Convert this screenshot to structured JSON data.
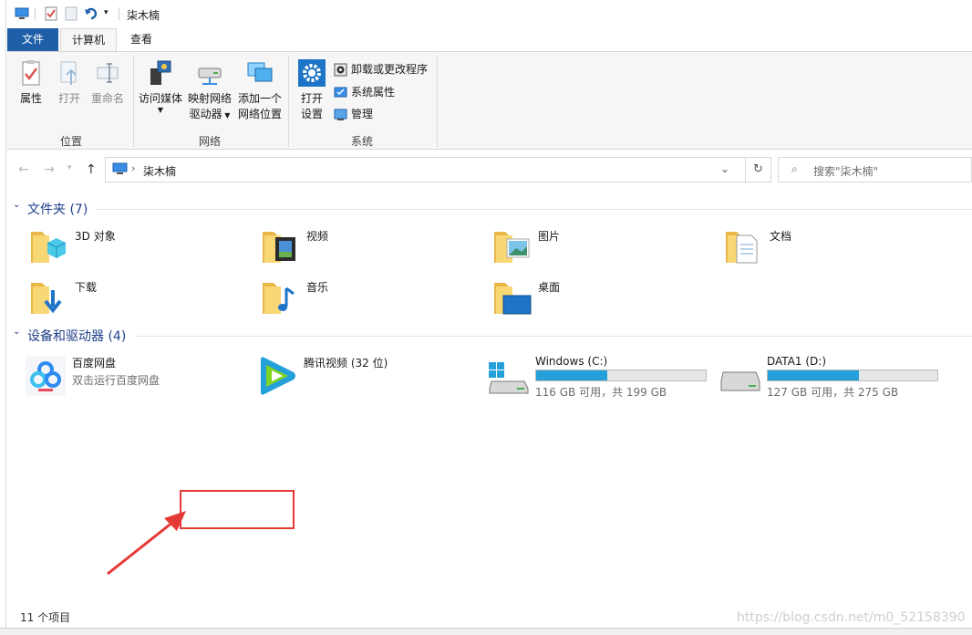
{
  "window": {
    "title": "柒木楠"
  },
  "tabs": {
    "file": "文件",
    "computer": "计算机",
    "view": "查看"
  },
  "ribbon": {
    "location": {
      "label": "位置",
      "properties": "属性",
      "open": "打开",
      "rename": "重命名"
    },
    "network": {
      "label": "网络",
      "media": "访问媒体",
      "map_l1": "映射网络",
      "map_l2": "驱动器",
      "add_l1": "添加一个",
      "add_l2": "网络位置"
    },
    "system": {
      "label": "系统",
      "settings_l1": "打开",
      "settings_l2": "设置",
      "uninstall": "卸载或更改程序",
      "sysprops": "系统属性",
      "manage": "管理"
    }
  },
  "nav": {
    "breadcrumb": "柒木楠",
    "search_placeholder": "搜索\"柒木楠\""
  },
  "folders": {
    "title": "文件夹 (7)",
    "items": [
      "3D 对象",
      "视频",
      "图片",
      "文档",
      "下载",
      "音乐",
      "桌面"
    ]
  },
  "devices": {
    "title": "设备和驱动器 (4)",
    "baidu": {
      "name": "百度网盘",
      "sub": "双击运行百度网盘"
    },
    "tencent": {
      "name": "腾讯视频 (32 位)"
    },
    "c": {
      "name": "Windows (C:)",
      "info": "116 GB 可用，共 199 GB",
      "used_fraction": 0.417
    },
    "d": {
      "name": "DATA1 (D:)",
      "info": "127 GB 可用，共 275 GB",
      "used_fraction": 0.538
    }
  },
  "status": {
    "count": "11 个项目"
  },
  "watermark": "https://blog.csdn.net/m0_52158390",
  "colors": {
    "accent": "#1f5fa8",
    "drive_fill": "#26a0da",
    "highlight": "#e53935",
    "section": "#1e3f8a"
  }
}
